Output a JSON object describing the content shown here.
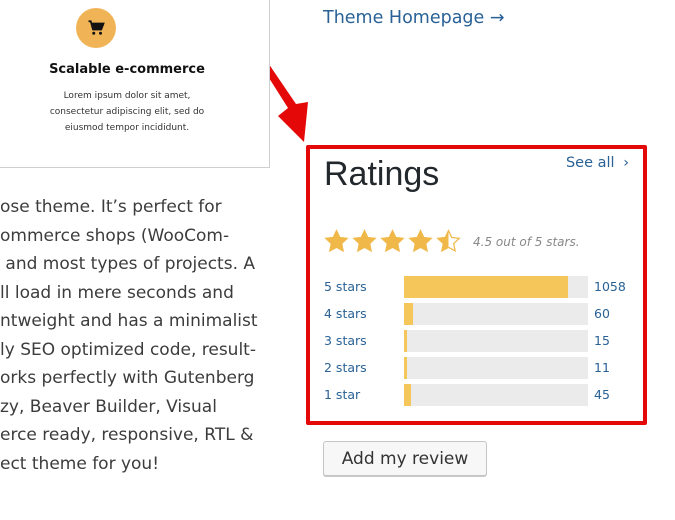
{
  "feature_card": {
    "icon": "cart-icon",
    "title": "Scalable e-commerce",
    "text_lines": [
      "Lorem ipsum dolor sit amet,",
      "consectetur adipiscing elit, sed do",
      "eiusmod tempor incididunt."
    ]
  },
  "description_lines": [
    "ose theme. It’s perfect for",
    "ommerce shops (WooCom-",
    " and most types of projects. A",
    "ll load in mere seconds and",
    "ntweight and has a minimalist",
    "ly SEO optimized code, result-",
    "orks perfectly with Gutenberg",
    "zy, Beaver Builder, Visual",
    "erce ready, responsive, RTL &",
    "ect theme for you!"
  ],
  "theme_homepage": {
    "label": "Theme Homepage →"
  },
  "ratings": {
    "title": "Ratings",
    "see_all": "See all",
    "average": 4.5,
    "max": 5,
    "summary": "4.5 out of 5 stars.",
    "colors": {
      "star": "#f0b849",
      "bar_fill": "#f5c659",
      "bar_track": "#ebebeb",
      "highlight": "#e40808"
    },
    "rows": [
      {
        "label": "5 stars",
        "count": "1058",
        "value": 1058
      },
      {
        "label": "4 stars",
        "count": "60",
        "value": 60
      },
      {
        "label": "3 stars",
        "count": "15",
        "value": 15
      },
      {
        "label": "2 stars",
        "count": "11",
        "value": 11
      },
      {
        "label": "1 star",
        "count": "45",
        "value": 45
      }
    ]
  },
  "add_review": {
    "label": "Add my review"
  }
}
